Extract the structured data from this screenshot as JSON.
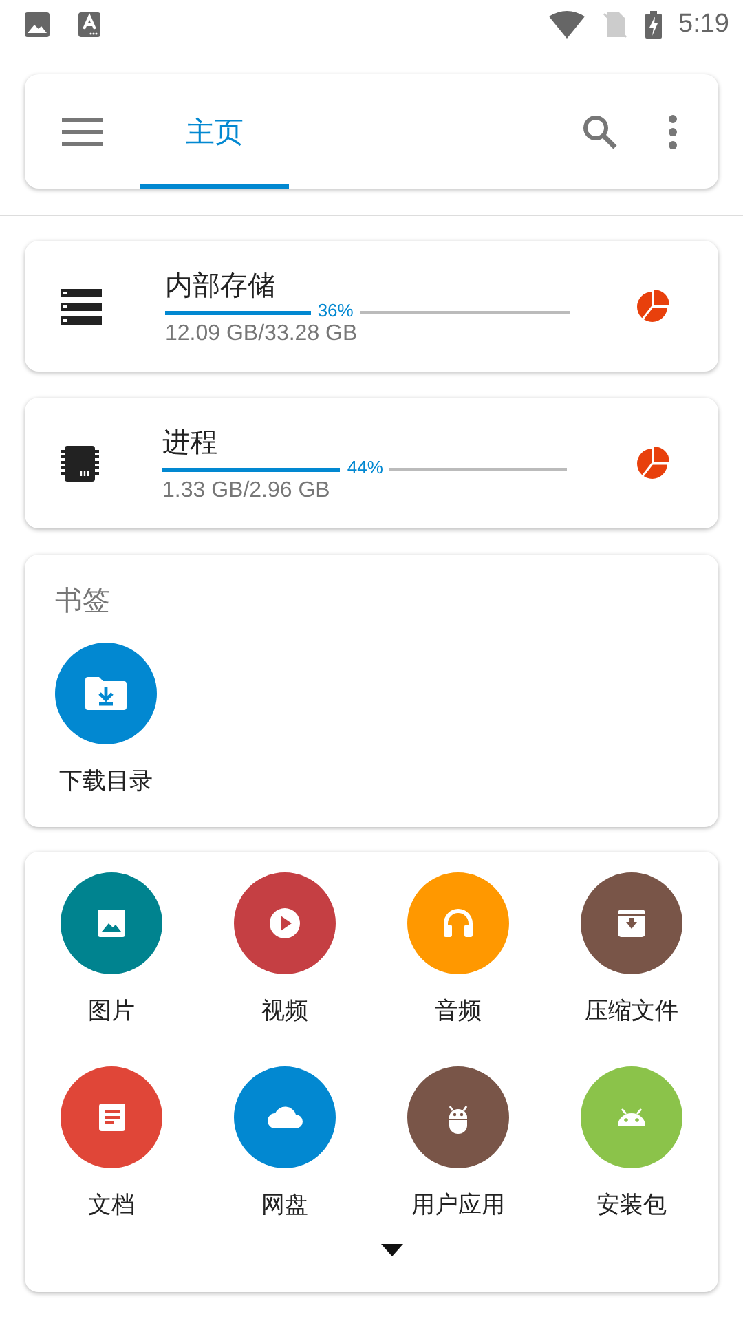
{
  "status_bar": {
    "time": "5:19"
  },
  "toolbar": {
    "tabs": [
      {
        "label": "主页",
        "selected": true
      }
    ]
  },
  "storage": [
    {
      "kind": "storage",
      "title": "内部存储",
      "level": 0.36,
      "percent": "36%",
      "usage": "12.09 GB/33.28 GB"
    },
    {
      "kind": "memory",
      "title": "进程",
      "level": 0.44,
      "percent": "44%",
      "usage": "1.33 GB/2.96 GB"
    }
  ],
  "bookmarks": {
    "title": "书签",
    "items": [
      {
        "label": "下载目录",
        "color": "#0288d1"
      }
    ]
  },
  "categories": [
    {
      "kind": "image",
      "label": "图片",
      "color": "#00838f"
    },
    {
      "kind": "video",
      "label": "视频",
      "color": "#c53f43"
    },
    {
      "kind": "audio",
      "label": "音频",
      "color": "#ff9800"
    },
    {
      "kind": "archive",
      "label": "压缩文件",
      "color": "#795548"
    },
    {
      "kind": "document",
      "label": "文档",
      "color": "#e04638"
    },
    {
      "kind": "cloud",
      "label": "网盘",
      "color": "#0288d1"
    },
    {
      "kind": "app",
      "label": "用户应用",
      "color": "#795548"
    },
    {
      "kind": "apk",
      "label": "安装包",
      "color": "#8bc34a"
    }
  ]
}
